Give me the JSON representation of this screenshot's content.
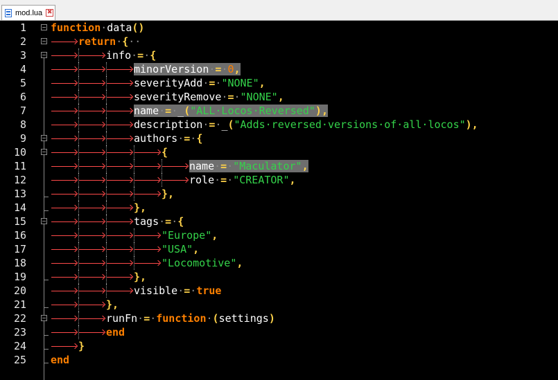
{
  "tab": {
    "label": "mod.lua",
    "close_glyph": "✖",
    "file_icon": "lua-file-icon"
  },
  "colors": {
    "keyword": "#ff8000",
    "identifier": "#ffffff",
    "operator": "#ffd24a",
    "string": "#34d34a",
    "number": "#ff8000",
    "whitespace_marker": "#8a8a8a",
    "tab_arrow": "#ff4a4a",
    "selection_highlight": "#6e6e6e",
    "background": "#000000"
  },
  "editor": {
    "lines": [
      {
        "n": "1",
        "indent": 0,
        "fold": "minus",
        "tokens": [
          [
            "kw",
            "function"
          ],
          [
            "dot",
            "·"
          ],
          [
            "id",
            "data"
          ],
          [
            "op",
            "()"
          ]
        ]
      },
      {
        "n": "2",
        "indent": 1,
        "fold": "minus",
        "tokens": [
          [
            "kw",
            "return"
          ],
          [
            "dot",
            "·"
          ],
          [
            "op",
            "{"
          ],
          [
            "dot",
            "··"
          ]
        ]
      },
      {
        "n": "3",
        "indent": 2,
        "fold": "minus",
        "tokens": [
          [
            "id",
            "info"
          ],
          [
            "dot",
            "·"
          ],
          [
            "op",
            "="
          ],
          [
            "dot",
            "·"
          ],
          [
            "op",
            "{"
          ]
        ]
      },
      {
        "n": "4",
        "indent": 3,
        "fold": "",
        "tokens": [
          [
            "id",
            "minorVersion",
            "hl"
          ],
          [
            "dot",
            "·",
            "hl"
          ],
          [
            "op",
            "=",
            "hl"
          ],
          [
            "dot",
            "·",
            "hl"
          ],
          [
            "num",
            "0",
            "hl"
          ],
          [
            "op",
            ",",
            "hl"
          ]
        ]
      },
      {
        "n": "5",
        "indent": 3,
        "fold": "",
        "tokens": [
          [
            "id",
            "severityAdd"
          ],
          [
            "dot",
            "·"
          ],
          [
            "op",
            "="
          ],
          [
            "dot",
            "·"
          ],
          [
            "str",
            "\"NONE\""
          ],
          [
            "op",
            ","
          ]
        ]
      },
      {
        "n": "6",
        "indent": 3,
        "fold": "",
        "tokens": [
          [
            "id",
            "severityRemove"
          ],
          [
            "dot",
            "·"
          ],
          [
            "op",
            "="
          ],
          [
            "dot",
            "·"
          ],
          [
            "str",
            "\"NONE\""
          ],
          [
            "op",
            ","
          ]
        ]
      },
      {
        "n": "7",
        "indent": 3,
        "fold": "",
        "tokens": [
          [
            "id",
            "name",
            "hl"
          ],
          [
            "dot",
            "·",
            "hl"
          ],
          [
            "op",
            "=",
            "hl"
          ],
          [
            "dot",
            "·",
            "hl"
          ],
          [
            "id",
            "_",
            "hl"
          ],
          [
            "op",
            "(",
            "hl"
          ],
          [
            "str",
            "\"ALL·Locos·Reversed\"",
            "hl"
          ],
          [
            "op",
            ")",
            "hl"
          ],
          [
            "op",
            ",",
            "hl"
          ]
        ]
      },
      {
        "n": "8",
        "indent": 3,
        "fold": "",
        "tokens": [
          [
            "id",
            "description"
          ],
          [
            "dot",
            "·"
          ],
          [
            "op",
            "="
          ],
          [
            "dot",
            "·"
          ],
          [
            "id",
            "_"
          ],
          [
            "op",
            "("
          ],
          [
            "str",
            "\"Adds·reversed·versions·of·all·locos\""
          ],
          [
            "op",
            "),"
          ]
        ]
      },
      {
        "n": "9",
        "indent": 3,
        "fold": "minus",
        "tokens": [
          [
            "id",
            "authors"
          ],
          [
            "dot",
            "·"
          ],
          [
            "op",
            "="
          ],
          [
            "dot",
            "·"
          ],
          [
            "op",
            "{"
          ]
        ]
      },
      {
        "n": "10",
        "indent": 4,
        "fold": "minus",
        "tokens": [
          [
            "op",
            "{"
          ]
        ]
      },
      {
        "n": "11",
        "indent": 5,
        "fold": "",
        "tokens": [
          [
            "id",
            "name",
            "hl"
          ],
          [
            "dot",
            "·",
            "hl"
          ],
          [
            "op",
            "=",
            "hl"
          ],
          [
            "dot",
            "·",
            "hl"
          ],
          [
            "str",
            "\"Maculator\"",
            "hl"
          ],
          [
            "op",
            ",",
            "hl"
          ]
        ]
      },
      {
        "n": "12",
        "indent": 5,
        "fold": "",
        "tokens": [
          [
            "id",
            "role"
          ],
          [
            "dot",
            "·"
          ],
          [
            "op",
            "="
          ],
          [
            "dot",
            "·"
          ],
          [
            "str",
            "\"CREATOR\""
          ],
          [
            "op",
            ","
          ]
        ]
      },
      {
        "n": "13",
        "indent": 4,
        "fold": "end",
        "tokens": [
          [
            "op",
            "},"
          ]
        ]
      },
      {
        "n": "14",
        "indent": 3,
        "fold": "end",
        "tokens": [
          [
            "op",
            "},"
          ]
        ]
      },
      {
        "n": "15",
        "indent": 3,
        "fold": "minus",
        "tokens": [
          [
            "id",
            "tags"
          ],
          [
            "dot",
            "·"
          ],
          [
            "op",
            "="
          ],
          [
            "dot",
            "·"
          ],
          [
            "op",
            "{"
          ]
        ]
      },
      {
        "n": "16",
        "indent": 4,
        "fold": "",
        "tokens": [
          [
            "str",
            "\"Europe\""
          ],
          [
            "op",
            ","
          ]
        ]
      },
      {
        "n": "17",
        "indent": 4,
        "fold": "",
        "tokens": [
          [
            "str",
            "\"USA\""
          ],
          [
            "op",
            ","
          ]
        ]
      },
      {
        "n": "18",
        "indent": 4,
        "fold": "",
        "tokens": [
          [
            "str",
            "\"Locomotive\""
          ],
          [
            "op",
            ","
          ]
        ]
      },
      {
        "n": "19",
        "indent": 3,
        "fold": "end",
        "tokens": [
          [
            "op",
            "},"
          ]
        ]
      },
      {
        "n": "20",
        "indent": 3,
        "fold": "",
        "tokens": [
          [
            "id",
            "visible"
          ],
          [
            "dot",
            "·"
          ],
          [
            "op",
            "="
          ],
          [
            "dot",
            "·"
          ],
          [
            "kw",
            "true"
          ]
        ]
      },
      {
        "n": "21",
        "indent": 2,
        "fold": "end",
        "tokens": [
          [
            "op",
            "},"
          ]
        ]
      },
      {
        "n": "22",
        "indent": 2,
        "fold": "minus",
        "tokens": [
          [
            "id",
            "runFn"
          ],
          [
            "dot",
            "·"
          ],
          [
            "op",
            "="
          ],
          [
            "dot",
            "·"
          ],
          [
            "kw",
            "function"
          ],
          [
            "dot",
            "·"
          ],
          [
            "op",
            "("
          ],
          [
            "id",
            "settings"
          ],
          [
            "op",
            ")"
          ]
        ]
      },
      {
        "n": "23",
        "indent": 2,
        "fold": "end",
        "tokens": [
          [
            "kw",
            "end"
          ]
        ]
      },
      {
        "n": "24",
        "indent": 1,
        "fold": "end",
        "tokens": [
          [
            "op",
            "}"
          ]
        ]
      },
      {
        "n": "25",
        "indent": 0,
        "fold": "end",
        "tokens": [
          [
            "kw",
            "end"
          ]
        ]
      }
    ]
  }
}
